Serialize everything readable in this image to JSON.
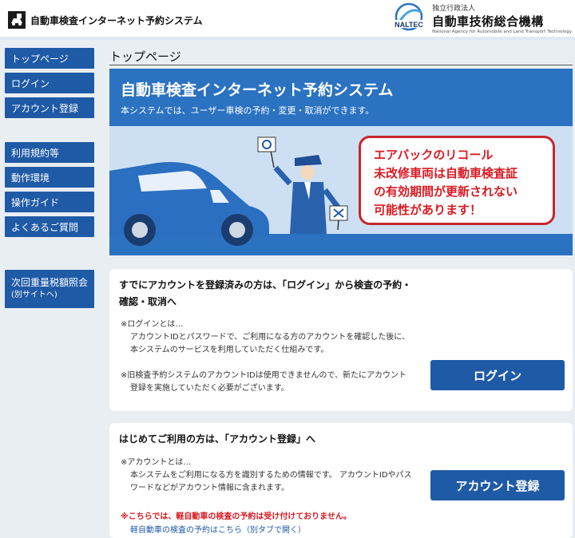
{
  "header": {
    "app_title": "自動車検査インターネット予約システム",
    "org_logo_text": "NALTEC",
    "org_sub": "独立行政法人",
    "org_name": "自動車技術総合機構",
    "org_en": "National Agency for Automobile and Land Transport Technology"
  },
  "sidebar": {
    "items": [
      {
        "label": "トップページ"
      },
      {
        "label": "ログイン"
      },
      {
        "label": "アカウント登録"
      },
      {
        "label": "利用規約等"
      },
      {
        "label": "動作環境"
      },
      {
        "label": "操作ガイド"
      },
      {
        "label": "よくあるご質問"
      }
    ],
    "tax_link": {
      "label": "次回重量税額照会",
      "sub": "(別サイトへ)"
    }
  },
  "page_title": "トップページ",
  "hero": {
    "title": "自動車検査インターネット予約システム",
    "subtitle": "本システムでは、ユーザー車検の予約・変更・取消ができます。",
    "alert_lines": [
      "エアバックのリコール",
      "未改修車両は自動車検査証",
      "の有効期間が更新されない",
      "可能性があります！"
    ]
  },
  "login_card": {
    "heading_1": "すでにアカウントを登録済みの方は、「ログイン」から検査の予約・",
    "heading_2": "確認・取消へ",
    "note1_title": "※ログインとは…",
    "note1_line1": "アカウントIDとパスワードで、ご利用になる方のアカウントを確認した後に、",
    "note1_line2": "本システムのサービスを利用していただく仕組みです。",
    "note2_line1": "※旧検査予約システムのアカウントIDは使用できませんので、新たにアカウント",
    "note2_line2": "登録を実施していただく必要がございます。",
    "button": "ログイン"
  },
  "register_card": {
    "heading": "はじめてご利用の方は、「アカウント登録」へ",
    "note_title": "※アカウントとは…",
    "note_line1": "本システムをご利用になる方を識別するための情報です。 アカウントIDやパス",
    "note_line2": "ワードなどがアカウント情報に含まれます。",
    "button": "アカウント登録",
    "warning": "※こちらでは、軽自動車の検査の予約は受け付けておりません。",
    "kei_link": "軽自動車の検査の予約はこちら（別タブで開く）"
  },
  "colors": {
    "accent": "#1f5aa6",
    "hero_band": "#2b72c1",
    "alert_red": "#d81b23",
    "background": "#e9eef3"
  }
}
